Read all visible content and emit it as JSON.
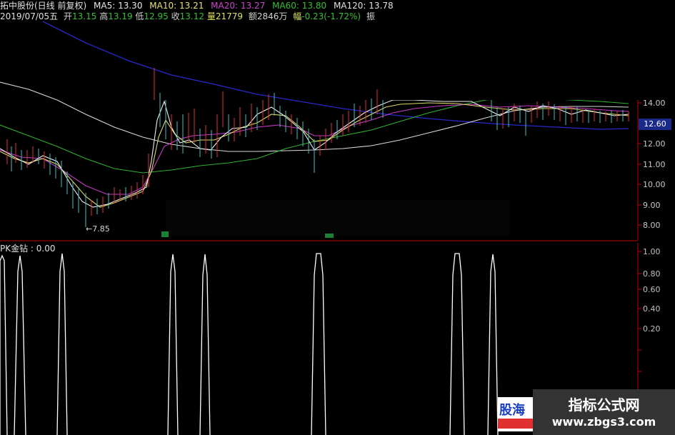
{
  "header": {
    "stock_name": "拓中股份(日线 前复权)",
    "date": "2019/07/05五",
    "ma5_label": "MA5:",
    "ma5_value": "13.30",
    "ma10_label": "MA10:",
    "ma10_value": "13.21",
    "ma20_label": "MA20:",
    "ma20_value": "13.27",
    "ma60_label": "MA60:",
    "ma60_value": "13.80",
    "ma120_label": "MA120:",
    "ma120_value": "13.78",
    "open_label": "开",
    "open_value": "13.15",
    "high_label": "高",
    "high_value": "13.19",
    "low_label": "低",
    "low_value": "12.95",
    "close_label": "收",
    "close_value": "13.12",
    "volume_label": "量",
    "volume_value": "21779",
    "amount_label": "额",
    "amount_value": "2846万",
    "change_label": "幅",
    "change_value": "-0.23(-1.72%)",
    "amplitude_label": "振"
  },
  "main_chart": {
    "price_axis_labels": [
      "14.00",
      "13.00",
      "12.00",
      "11.00",
      "10.00",
      "9.00",
      "8.00"
    ],
    "current_price_tag": "12.60",
    "low_marker": "←7.85",
    "colors": {
      "ma5": "#e8e8e8",
      "ma10": "#e8e070",
      "ma20": "#d040d0",
      "ma60": "#30b030",
      "ma120": "#d8d8d8",
      "ma250": "#3030d0",
      "up_candle": "#e03030",
      "down_candle": "#40c0c0",
      "axis": "#c00000"
    }
  },
  "indicator": {
    "title": "PK金钻 : 0.00",
    "axis_labels": [
      "1.00",
      "0.80",
      "0.60",
      "0.40",
      "0.20"
    ],
    "color": "#ffffff"
  },
  "watermark": {
    "left_text": "股海",
    "right_title": "指标公式网",
    "right_url": "www.zbgs3.com"
  }
}
